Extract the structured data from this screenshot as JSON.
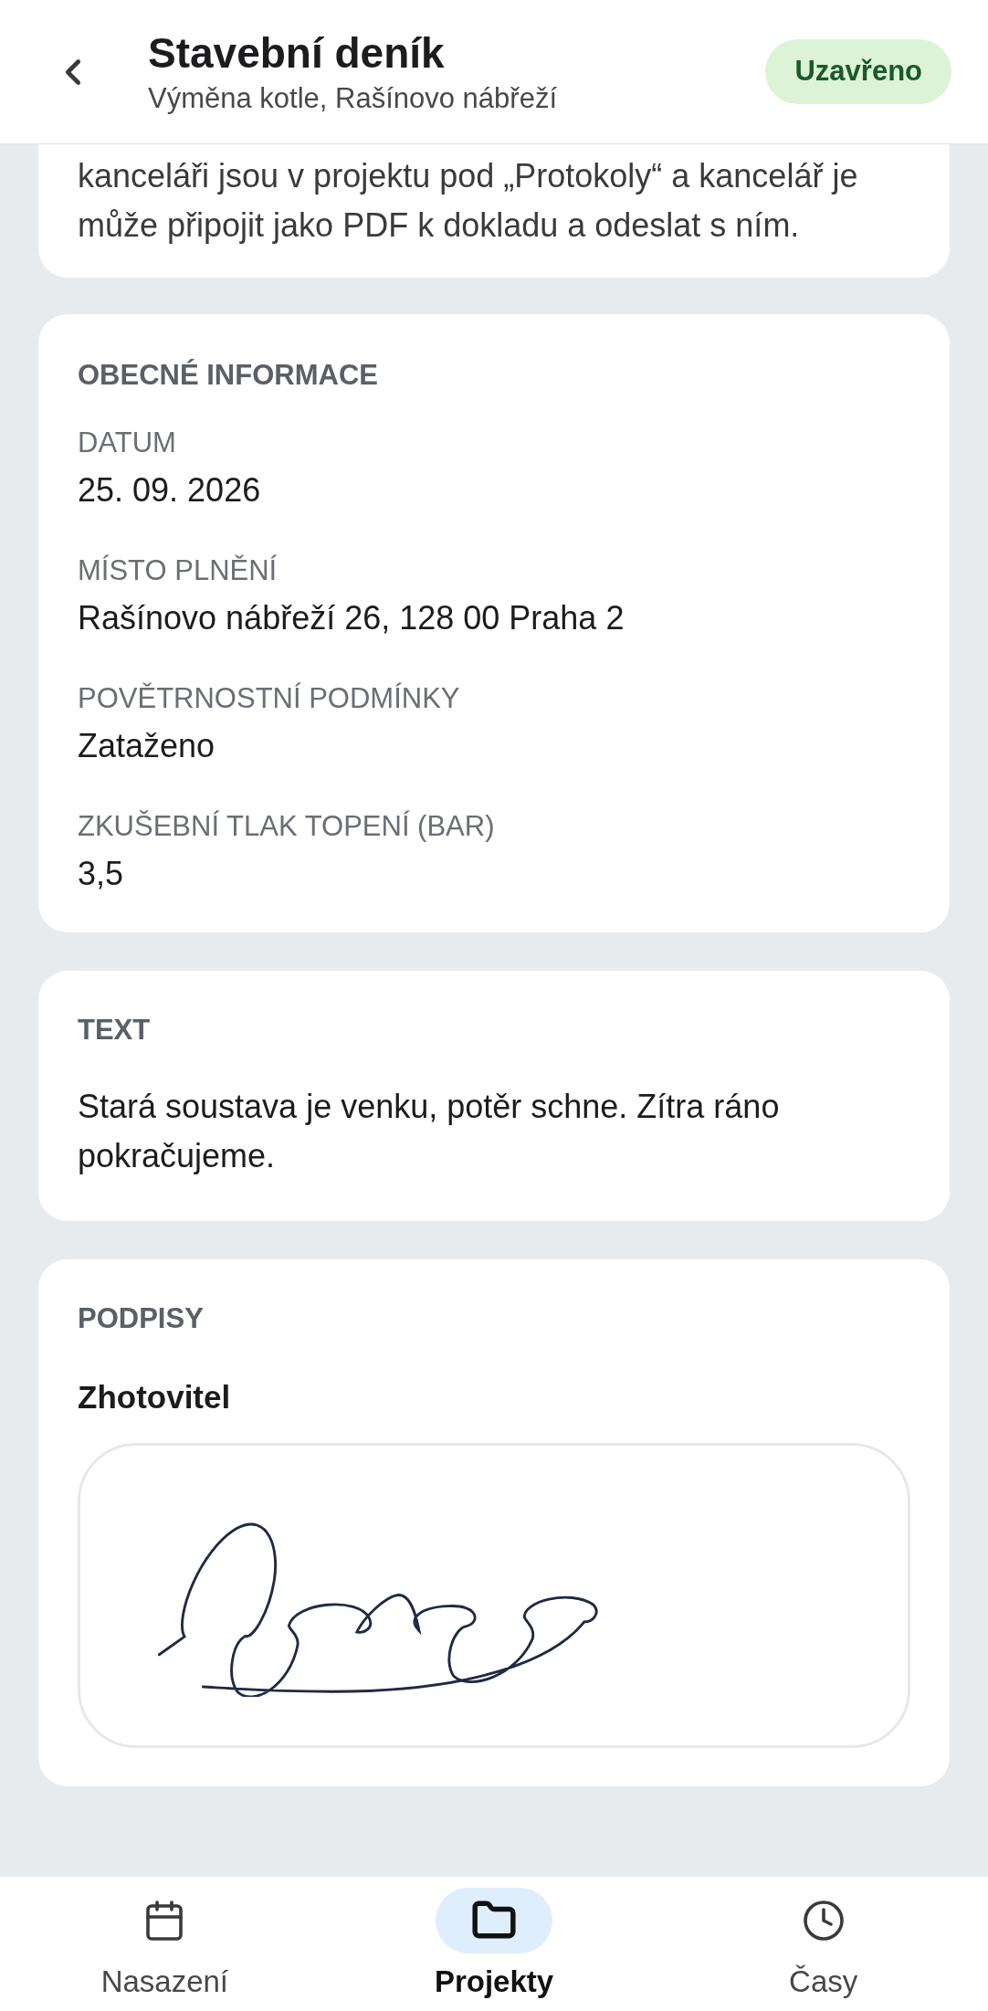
{
  "header": {
    "title": "Stavební deník",
    "subtitle": "Výměna kotle, Rašínovo nábřeží",
    "status": "Uzavřeno"
  },
  "note": {
    "text": "kanceláři jsou v projektu pod „Protokoly“ a kancelář je může připojit jako PDF k dokladu a odeslat s ním."
  },
  "general": {
    "heading": "OBECNÉ INFORMACE",
    "fields": [
      {
        "label": "DATUM",
        "value": "25. 09. 2026"
      },
      {
        "label": "MÍSTO PLNĚNÍ",
        "value": "Rašínovo nábřeží 26, 128 00 Praha 2"
      },
      {
        "label": "POVĚTRNOSTNÍ PODMÍNKY",
        "value": "Zataženo"
      },
      {
        "label": "ZKUŠEBNÍ TLAK TOPENÍ (BAR)",
        "value": "3,5"
      }
    ]
  },
  "text_section": {
    "heading": "TEXT",
    "body": "Stará soustava je venku, potěr schne. Zítra ráno pokračujeme."
  },
  "signatures": {
    "heading": "PODPISY",
    "items": [
      {
        "role": "Zhotovitel"
      }
    ]
  },
  "bottom_nav": [
    {
      "kind": "calendar",
      "label": "Nasazení",
      "selected": false
    },
    {
      "kind": "folder",
      "label": "Projekty",
      "selected": true
    },
    {
      "kind": "clock",
      "label": "Časy",
      "selected": false
    }
  ]
}
